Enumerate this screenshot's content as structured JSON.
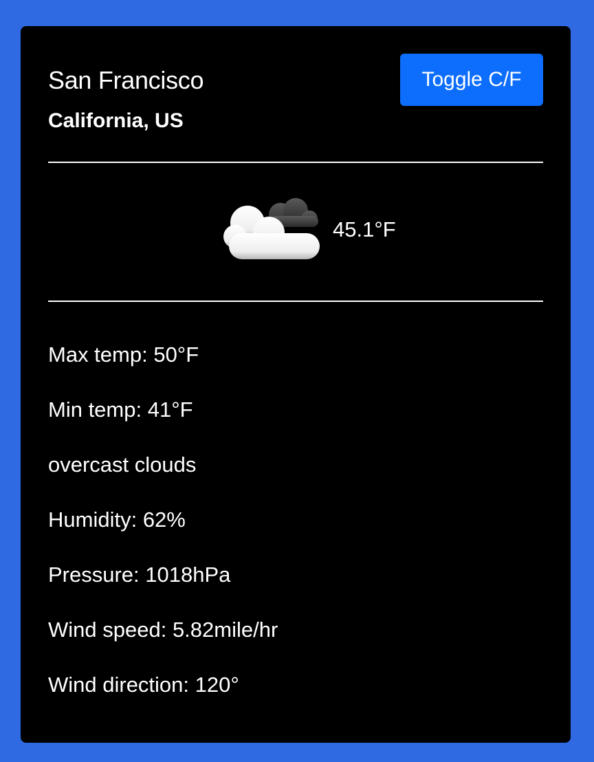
{
  "location": {
    "city": "San Francisco",
    "region": "California, US"
  },
  "toggle_label": "Toggle C/F",
  "current": {
    "icon": "overcast-clouds-icon",
    "temperature": "45.1°F"
  },
  "details": {
    "max_temp": {
      "label": "Max temp: ",
      "value": "50°F"
    },
    "min_temp": {
      "label": "Min temp: ",
      "value": "41°F"
    },
    "description": "overcast clouds",
    "humidity": {
      "label": "Humidity: ",
      "value": "62%"
    },
    "pressure": {
      "label": "Pressure: ",
      "value": "1018hPa"
    },
    "wind_speed": {
      "label": "Wind speed: ",
      "value": "5.82mile/hr"
    },
    "wind_direction": {
      "label": "Wind direction: ",
      "value": "120°"
    }
  },
  "colors": {
    "page_background": "#2f6ae3",
    "card_background": "#000000",
    "button": "#0d6efd",
    "text": "#ffffff"
  }
}
